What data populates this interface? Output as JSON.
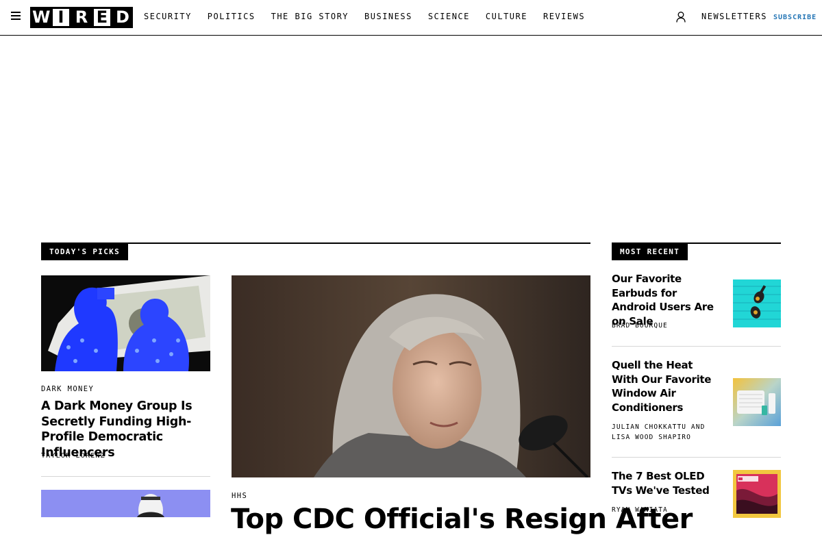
{
  "header": {
    "logo_letters": [
      "W",
      "I",
      "R",
      "E",
      "D"
    ],
    "nav": [
      "SECURITY",
      "POLITICS",
      "THE BIG STORY",
      "BUSINESS",
      "SCIENCE",
      "CULTURE",
      "REVIEWS"
    ],
    "newsletters": "NEWSLETTERS",
    "subscribe": "SUBSCRIBE"
  },
  "todays_picks": {
    "label": "TODAY'S PICKS",
    "story1": {
      "kicker": "DARK MONEY",
      "headline": "A Dark Money Group Is Secretly Funding High-Profile Democratic Influencers",
      "byline": "TAYLOR LORENZ"
    },
    "feature": {
      "kicker": "HHS",
      "headline": "Top CDC Official's Resign After"
    }
  },
  "most_recent": {
    "label": "MOST RECENT",
    "items": [
      {
        "headline": "Our Favorite Earbuds for Android Users Are on Sale",
        "byline": "BRAD BOURQUE"
      },
      {
        "headline": "Quell the Heat With Our Favorite Window Air Conditioners",
        "byline": "JULIAN CHOKKATTU AND LISA WOOD SHAPIRO"
      },
      {
        "headline": "The 7 Best OLED TVs We've Tested",
        "byline": "RYAN WANIATA"
      }
    ]
  },
  "colors": {
    "accent": "#2475b5",
    "text": "#000000",
    "divider": "#d6d6d6"
  },
  "icons": [
    "hamburger-menu-icon",
    "user-icon"
  ]
}
